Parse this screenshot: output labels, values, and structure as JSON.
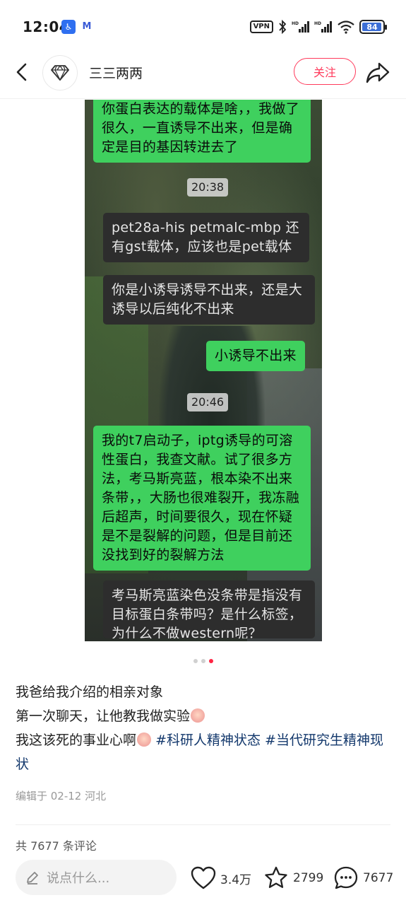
{
  "status": {
    "time": "12:04",
    "app_icons": [
      "accessibility-icon",
      "mail-icon"
    ],
    "vpn": "VPN",
    "battery": "84"
  },
  "nav": {
    "username": "三三两两",
    "follow_label": "关注"
  },
  "post_image": {
    "messages": [
      {
        "type": "green",
        "text": "你蛋白表达的载体是啥，，我做了很久，一直诱导不出来，但是确定是目的基因转进去了"
      },
      {
        "type": "time",
        "text": "20:38"
      },
      {
        "type": "dark",
        "text": "pet28a-his petmalc-mbp 还有gst载体，应该也是pet载体"
      },
      {
        "type": "dark",
        "text": "你是小诱导诱导不出来，还是大诱导以后纯化不出来"
      },
      {
        "type": "green",
        "text": "小诱导不出来"
      },
      {
        "type": "time",
        "text": "20:46"
      },
      {
        "type": "green",
        "text": "我的t7启动子，iptg诱导的可溶性蛋白，我查文献。试了很多方法，考马斯亮蓝，根本染不出来条带，，大肠也很难裂开，我冻融后超声，时间要很久，现在怀疑是不是裂解的问题，但是目前还没找到好的裂解方法"
      },
      {
        "type": "dark",
        "text": "考马斯亮蓝染色没条带是指没有目标蛋白条带吗？是什么标签，为什么不做western呢？"
      }
    ],
    "carousel_total": 3,
    "carousel_active": 3
  },
  "post": {
    "line1": "我爸给我介绍的相亲对象",
    "line2": "第一次聊天，让他教我做实验",
    "line3": "我这该死的事业心啊",
    "tag1": "#科研人精神状态",
    "tag2": "#当代研究生精神现状",
    "edited": "编辑于 02-12 河北",
    "comment_total": "共 7677 条评论"
  },
  "bottom_bar": {
    "placeholder": "说点什么...",
    "likes": "3.4万",
    "favorites": "2799",
    "comments": "7677"
  },
  "colors": {
    "accent": "#ff2442",
    "follow": "#ff3b5c",
    "tag": "#13386c",
    "wechat_green": "#3fd05e",
    "dark_bubble": "#2d2d2d"
  }
}
